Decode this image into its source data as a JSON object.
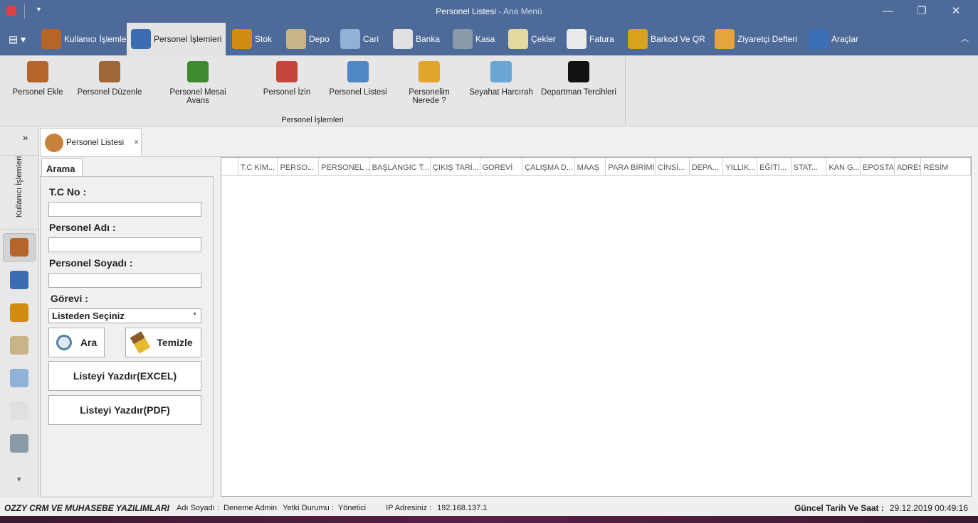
{
  "window": {
    "title": "Personel Listesi",
    "title_suffix": " - Ana Menü",
    "minimize": "—",
    "restore": "❐",
    "close": "✕"
  },
  "ribbon_tabs": [
    {
      "label": "Kullanıcı İşlemleri",
      "color": "#b5652a"
    },
    {
      "label": "Personel İşlemleri",
      "color": "#3b6db3"
    },
    {
      "label": "Stok",
      "color": "#d08d12"
    },
    {
      "label": "Depo",
      "color": "#c9b489"
    },
    {
      "label": "Cari",
      "color": "#8fb2d6"
    },
    {
      "label": "Banka",
      "color": "#e0e0e0"
    },
    {
      "label": "Kasa",
      "color": "#8a9aa6"
    },
    {
      "label": "Çekler",
      "color": "#e3d9a0"
    },
    {
      "label": "Fatura",
      "color": "#eaeaea"
    },
    {
      "label": "Barkod Ve QR",
      "color": "#d8a21b"
    },
    {
      "label": "Ziyaretçi Defteri",
      "color": "#e6a53c"
    },
    {
      "label": "Araçlar",
      "color": "#3a6fb8"
    }
  ],
  "ribbon_buttons": [
    {
      "label": "Personel Ekle",
      "color": "#b5652a"
    },
    {
      "label": "Personel Düzenle",
      "color": "#a06838"
    },
    {
      "label": "Personel Mesai Avans",
      "color": "#3e8a2e"
    },
    {
      "label": "Personel İzin",
      "color": "#c2463a"
    },
    {
      "label": "Personel Listesi",
      "color": "#4f86c6"
    },
    {
      "label": "Personelim Nerede ?",
      "color": "#e2a42b"
    },
    {
      "label": "Seyahat Harcırah",
      "color": "#6aa6d4"
    },
    {
      "label": "Departman Tercihleri",
      "color": "#111111"
    }
  ],
  "ribbon_group": "Personel İşlemleri",
  "left_nav": {
    "expand": "»",
    "vertical_label": "Kullanıcı İşlemleri",
    "more": "▾"
  },
  "doc_tab": {
    "label": "Personel Listesi",
    "close": "×"
  },
  "search": {
    "tab": "Arama",
    "tc_label": "T.C No :",
    "tc_value": "",
    "name_label": "Personel Adı :",
    "name_value": "",
    "surname_label": "Personel Soyadı :",
    "surname_value": "",
    "role_label": "Görevi :",
    "role_selected": "Listeden Seçiniz",
    "search_button": "Ara",
    "clear_button": "Temizle",
    "excel_button": "Listeyi Yazdır(EXCEL)",
    "pdf_button": "Listeyi Yazdır(PDF)"
  },
  "grid": {
    "columns": [
      "T.C KİM...",
      "PERSO...",
      "PERSONEL ...",
      "BAŞLANGIC T...",
      "ÇIKIŞ TARİ...",
      "GOREVİ",
      "ÇALIŞMA D...",
      "MAAŞ",
      "PARA BİRİMİ",
      "CİNSİ...",
      "DEPA...",
      "YILLIK...",
      "EĞİTİ...",
      "STAT...",
      "KAN G...",
      "EPOSTA",
      "ADRES",
      "RESİM"
    ]
  },
  "status": {
    "company": "OZZY CRM VE MUHASEBE YAZILIMLARI",
    "name_label": "Adı Soyadı :",
    "name": "Deneme Admin",
    "role_label": "Yetki Durumu :",
    "role": "Yönetici",
    "ip_label": "IP Adresiniz :",
    "ip": "192.168.137.1",
    "datetime_label": "Güncel Tarih Ve Saat :",
    "datetime": "29.12.2019 00:49:16"
  }
}
